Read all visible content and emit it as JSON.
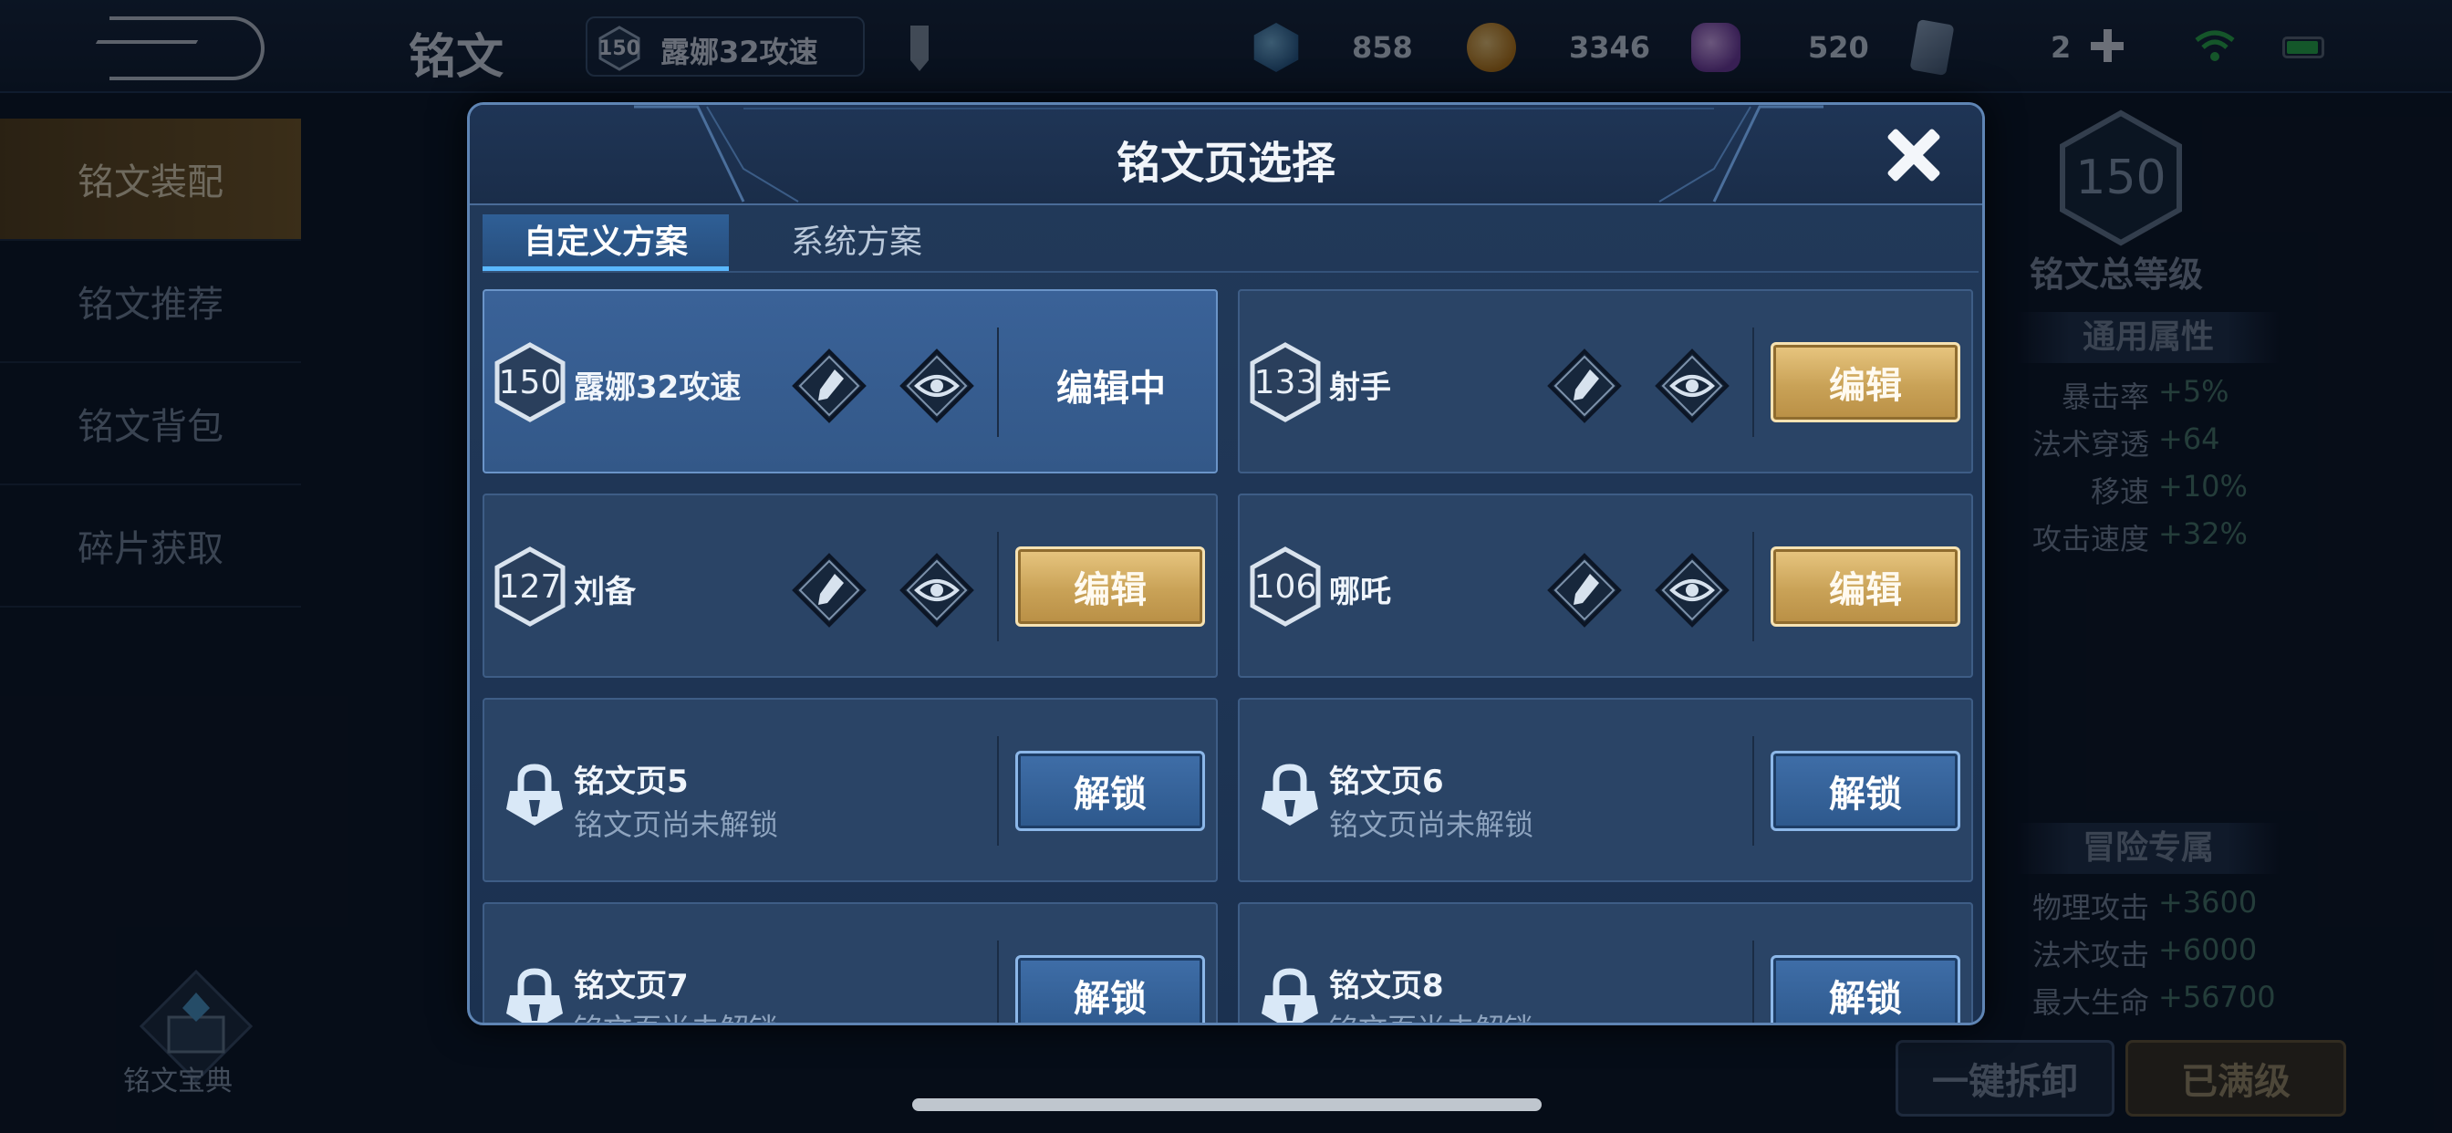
{
  "topbar": {
    "title": "铭文",
    "current_page": {
      "level": "150",
      "name": "露娜32攻速"
    },
    "resources": [
      {
        "icon": "crystal-icon",
        "value": "858"
      },
      {
        "icon": "coin-icon",
        "value": "3346"
      },
      {
        "icon": "gem-icon",
        "value": "520"
      },
      {
        "icon": "card-icon",
        "value": "2"
      }
    ]
  },
  "sidebar": {
    "items": [
      {
        "label": "铭文装配",
        "active": true
      },
      {
        "label": "铭文推荐"
      },
      {
        "label": "铭文背包"
      },
      {
        "label": "碎片获取"
      }
    ],
    "codex_label": "铭文宝典"
  },
  "right_panel": {
    "total_level": "150",
    "total_level_label": "铭文总等级",
    "general_title": "通用属性",
    "general_attrs": [
      {
        "name": "暴击率",
        "value": "+5%"
      },
      {
        "name": "法术穿透",
        "value": "+64"
      },
      {
        "name": "移速",
        "value": "+10%"
      },
      {
        "name": "攻击速度",
        "value": "+32%"
      }
    ],
    "adventure_title": "冒险专属",
    "adventure_attrs": [
      {
        "name": "物理攻击",
        "value": "+3600"
      },
      {
        "name": "法术攻击",
        "value": "+6000"
      },
      {
        "name": "最大生命",
        "value": "+56700"
      }
    ],
    "btn_unequip": "一键拆卸",
    "btn_maxed": "已满级"
  },
  "modal": {
    "title": "铭文页选择",
    "tabs": [
      {
        "label": "自定义方案",
        "active": true
      },
      {
        "label": "系统方案"
      }
    ],
    "pages": [
      {
        "level": "150",
        "name": "露娜32攻速",
        "status": "编辑中"
      },
      {
        "level": "133",
        "name": "射手",
        "action": "编辑"
      },
      {
        "level": "127",
        "name": "刘备",
        "action": "编辑"
      },
      {
        "level": "106",
        "name": "哪吒",
        "action": "编辑"
      }
    ],
    "locked_pages": [
      {
        "name": "铭文页5",
        "sub": "铭文页尚未解锁",
        "action": "解锁"
      },
      {
        "name": "铭文页6",
        "sub": "铭文页尚未解锁",
        "action": "解锁"
      },
      {
        "name": "铭文页7",
        "sub": "铭文页尚未解锁",
        "action": "解锁"
      },
      {
        "name": "铭文页8",
        "sub": "铭文页尚未解锁",
        "action": "解锁"
      }
    ]
  },
  "colors": {
    "gold": "#c9a257",
    "accent_blue": "#5ab8ff",
    "panel": "#223a5a"
  }
}
